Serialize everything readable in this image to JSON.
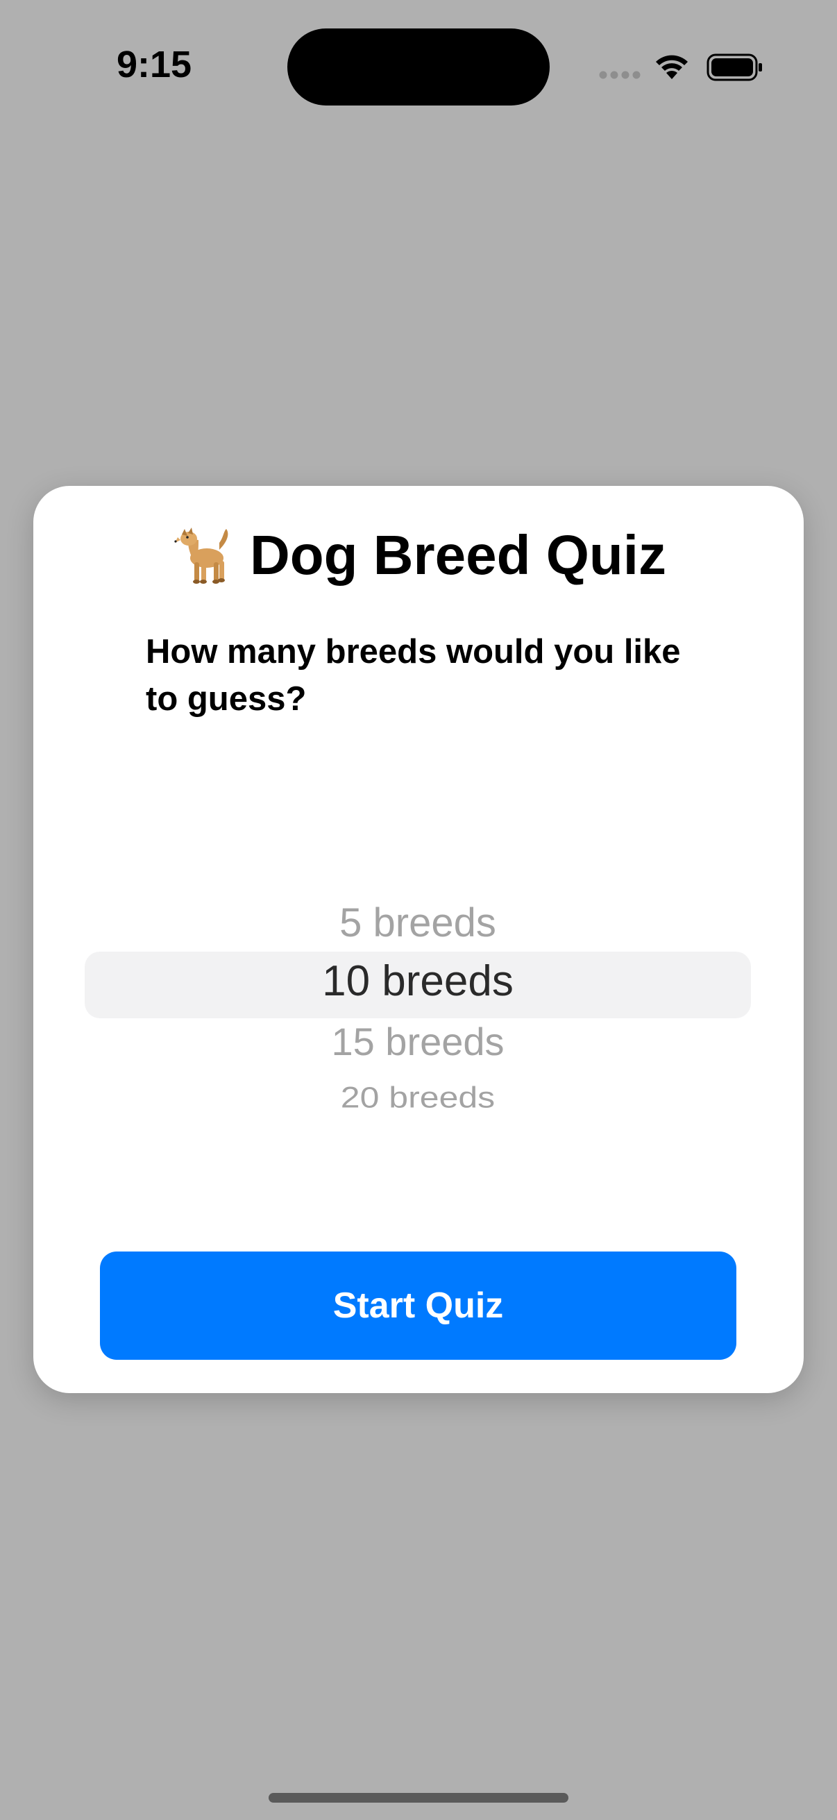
{
  "status_bar": {
    "time": "9:15"
  },
  "card": {
    "title_icon": "dog-emoji-icon",
    "title": "Dog Breed Quiz",
    "subtitle": "How many breeds would you like to guess?"
  },
  "picker": {
    "options": [
      "5 breeds",
      "10 breeds",
      "15 breeds",
      "20 breeds"
    ],
    "selected": "10 breeds"
  },
  "actions": {
    "start_label": "Start Quiz"
  },
  "colors": {
    "accent": "#007aff",
    "backdrop": "#b0b0b0",
    "card": "#ffffff"
  }
}
